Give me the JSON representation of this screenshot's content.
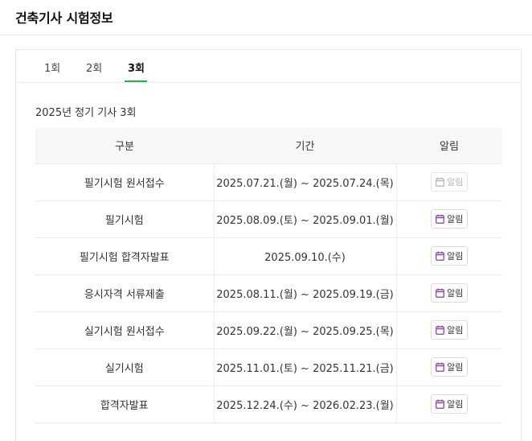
{
  "header": {
    "title": "건축기사 시험정보"
  },
  "tabs": [
    {
      "label": "1회"
    },
    {
      "label": "2회"
    },
    {
      "label": "3회"
    }
  ],
  "exam_title": "2025년 정기 기사 3회",
  "table": {
    "headers": [
      "구분",
      "기간",
      "알림"
    ],
    "rows": [
      {
        "category": "필기시험 원서접수",
        "period": "2025.07.21.(월) ~ 2025.07.24.(목)",
        "alarm": "알림",
        "alarm_enabled": false
      },
      {
        "category": "필기시험",
        "period": "2025.08.09.(토) ~ 2025.09.01.(월)",
        "alarm": "알림",
        "alarm_enabled": true
      },
      {
        "category": "필기시험 합격자발표",
        "period": "2025.09.10.(수)",
        "alarm": "알림",
        "alarm_enabled": true
      },
      {
        "category": "응시자격 서류제출",
        "period": "2025.08.11.(월) ~ 2025.09.19.(금)",
        "alarm": "알림",
        "alarm_enabled": true
      },
      {
        "category": "실기시험 원서접수",
        "period": "2025.09.22.(월) ~ 2025.09.25.(목)",
        "alarm": "알림",
        "alarm_enabled": true
      },
      {
        "category": "실기시험",
        "period": "2025.11.01.(토) ~ 2025.11.21.(금)",
        "alarm": "알림",
        "alarm_enabled": true
      },
      {
        "category": "합격자발표",
        "period": "2025.12.24.(수) ~ 2026.02.23.(월)",
        "alarm": "알림",
        "alarm_enabled": true
      }
    ]
  },
  "colors": {
    "accent": "#22b14c",
    "icon_purple": "#7b3fa0",
    "disabled": "#b5b5b5"
  },
  "icons": {
    "alarm": "calendar-icon"
  }
}
